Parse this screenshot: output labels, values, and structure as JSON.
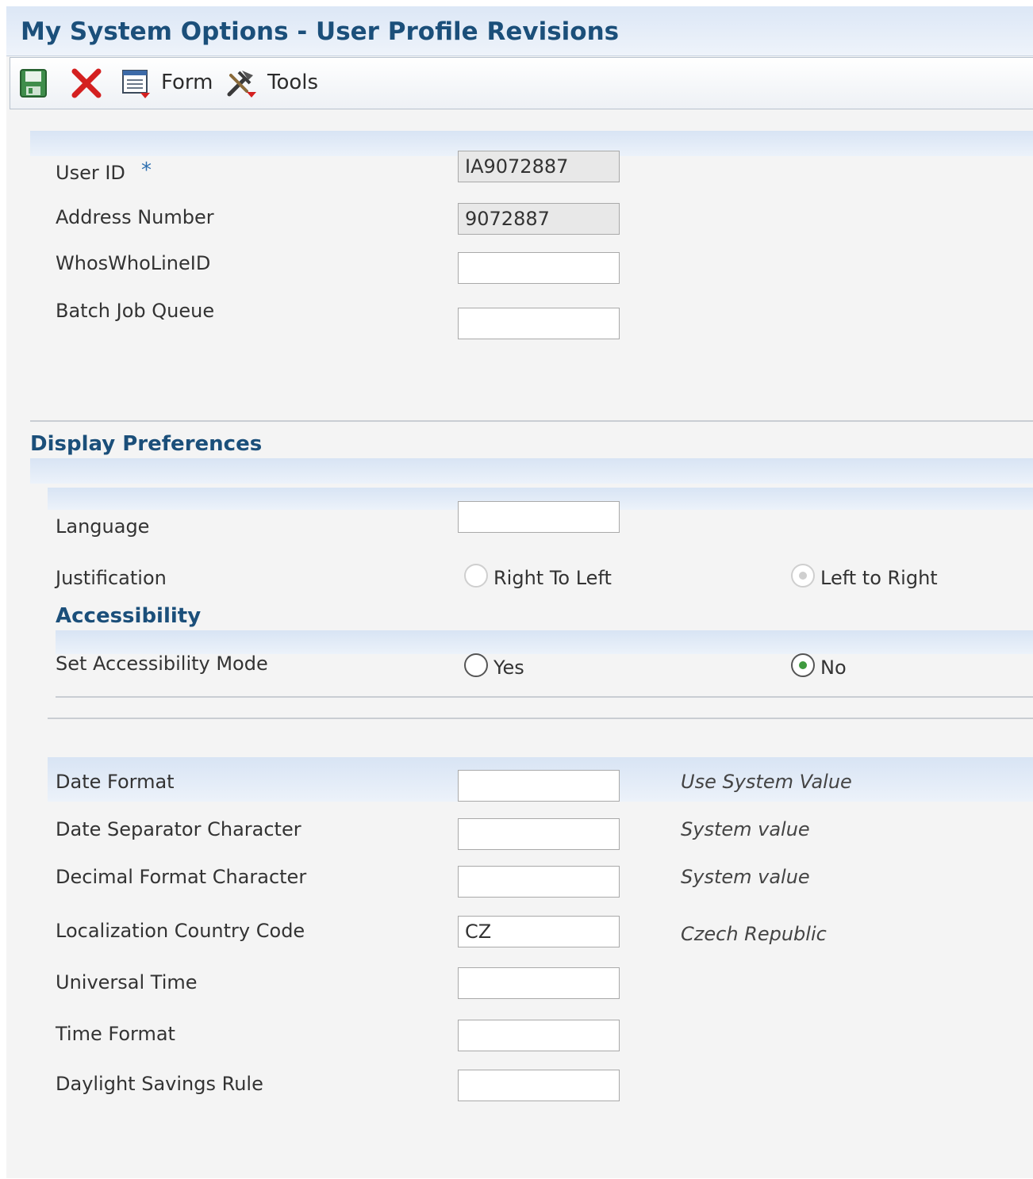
{
  "window": {
    "title": "My System Options - User Profile Revisions"
  },
  "toolbar": {
    "save_icon": "save-icon",
    "cancel_icon": "close-icon",
    "form_label": "Form",
    "tools_label": "Tools"
  },
  "fields": {
    "user_id": {
      "label": "User ID",
      "required_marker": "*",
      "value": "IA9072887"
    },
    "address_number": {
      "label": "Address Number",
      "value": "9072887"
    },
    "whoswho_line_id": {
      "label": "WhosWhoLineID",
      "value": ""
    },
    "batch_job_queue": {
      "label": "Batch Job Queue",
      "value": ""
    }
  },
  "display_preferences": {
    "heading": "Display Preferences",
    "language": {
      "label": "Language",
      "value": ""
    },
    "justification": {
      "label": "Justification",
      "options": [
        "Right To Left",
        "Left to Right"
      ],
      "selected": "Left to Right",
      "disabled": true
    },
    "accessibility": {
      "heading": "Accessibility",
      "mode_label": "Set Accessibility Mode",
      "options": [
        "Yes",
        "No"
      ],
      "selected": "No"
    }
  },
  "formats": {
    "date_format": {
      "label": "Date Format",
      "value": "",
      "hint": "Use System Value"
    },
    "date_separator": {
      "label": "Date Separator Character",
      "value": "",
      "hint": "System value"
    },
    "decimal_format": {
      "label": "Decimal Format Character",
      "value": "",
      "hint": "System value"
    },
    "localization_country_code": {
      "label": "Localization Country Code",
      "value": "CZ",
      "hint": "Czech Republic"
    },
    "universal_time": {
      "label": "Universal Time",
      "value": ""
    },
    "time_format": {
      "label": "Time Format",
      "value": ""
    },
    "daylight_savings_rule": {
      "label": "Daylight Savings Rule",
      "value": ""
    }
  },
  "colors": {
    "title": "#1b4f7a",
    "band": "#dce7f6",
    "selected_radio": "#3f9a3f",
    "cancel_red": "#d42020"
  }
}
